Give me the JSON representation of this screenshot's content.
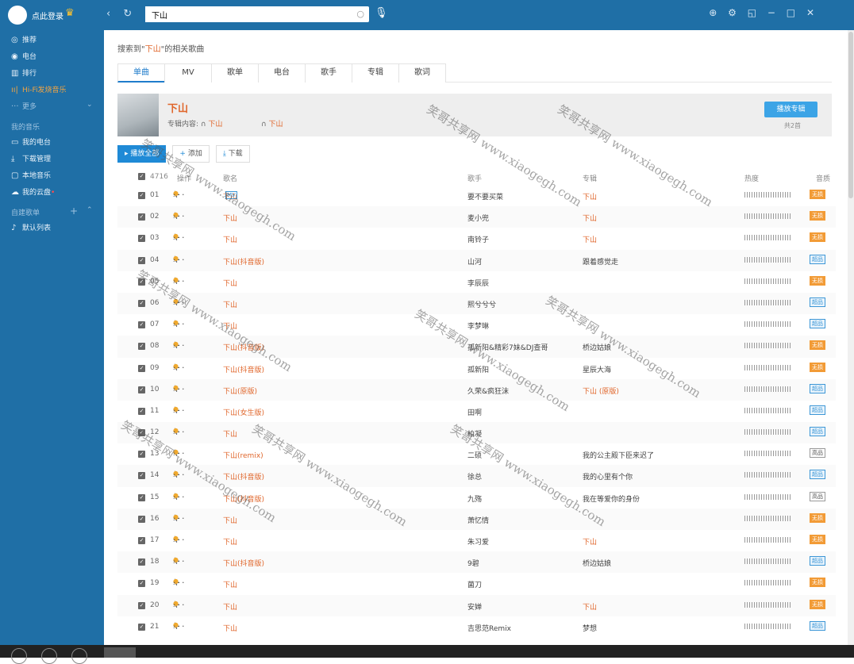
{
  "header": {
    "login_text": "点此登录",
    "search_value": "下山",
    "icons": [
      "back-icon",
      "refresh-icon",
      "search-icon",
      "mic-icon",
      "skin-icon",
      "settings-icon",
      "mini-mode-icon",
      "minimize-icon",
      "maximize-icon",
      "close-icon"
    ]
  },
  "sidebar": {
    "items": [
      {
        "icon": "◎",
        "label": "推荐"
      },
      {
        "icon": "◉",
        "label": "电台"
      },
      {
        "icon": "▥",
        "label": "排行"
      },
      {
        "icon": "ıı|",
        "label": "Hi-Fi发烧音乐"
      },
      {
        "icon": "···",
        "label": "更多"
      }
    ],
    "my_music_title": "我的音乐",
    "my_items": [
      {
        "icon": "▭",
        "label": "我的电台"
      },
      {
        "icon": "⤓",
        "label": "下载管理"
      },
      {
        "icon": "▢",
        "label": "本地音乐"
      },
      {
        "icon": "☁",
        "label": "我的云盘"
      }
    ],
    "playlist_title": "自建歌单",
    "playlist_items": [
      {
        "icon": "♪",
        "label": "默认列表"
      }
    ]
  },
  "search_result": {
    "prefix": "搜索到\"",
    "keyword": "下山",
    "suffix": "\"的相关歌曲"
  },
  "tabs": [
    "单曲",
    "MV",
    "歌单",
    "电台",
    "歌手",
    "专辑",
    "歌词"
  ],
  "album": {
    "title": "下山",
    "sub_label": "专辑内容:",
    "sub_item1": "下山",
    "sub_item2": "下山",
    "play_button": "播放专辑",
    "total": "共2首"
  },
  "buttons": {
    "play_all": "播放全部",
    "add": "添加",
    "download": "下载"
  },
  "table": {
    "headers": {
      "count": "4716",
      "ops": "操作",
      "title": "歌名",
      "singer": "歌手",
      "album": "专辑",
      "heat": "热度",
      "quality": "音质"
    },
    "rows": [
      {
        "num": "01",
        "title": "下山",
        "mv": "MV",
        "singer": "要不要买菜",
        "album": "下山",
        "album_orange": true,
        "quality": "无损",
        "qt": "ls"
      },
      {
        "num": "02",
        "title": "下山",
        "mv": "",
        "singer": "麦小兜",
        "album": "下山",
        "album_orange": true,
        "quality": "无损",
        "qt": "ls"
      },
      {
        "num": "03",
        "title": "下山",
        "mv": "",
        "singer": "南铃子",
        "album": "下山",
        "album_orange": true,
        "quality": "无损",
        "qt": "ls"
      },
      {
        "num": "04",
        "title": "下山(抖音版)",
        "mv": "",
        "singer": "山河",
        "album": "跟着感觉走",
        "album_orange": false,
        "quality": "超品",
        "qt": "sq"
      },
      {
        "num": "05",
        "title": "下山",
        "mv": "",
        "singer": "李辰辰",
        "album": "",
        "album_orange": false,
        "quality": "无损",
        "qt": "ls"
      },
      {
        "num": "06",
        "title": "下山",
        "mv": "",
        "singer": "熙兮兮兮",
        "album": "",
        "album_orange": false,
        "quality": "超品",
        "qt": "sq"
      },
      {
        "num": "07",
        "title": "下山",
        "mv": "",
        "singer": "李梦琳",
        "album": "",
        "album_orange": false,
        "quality": "超品",
        "qt": "sq"
      },
      {
        "num": "08",
        "title": "下山(抖音版)",
        "mv": "",
        "singer": "孤新阳&精彩7妹&DJ查哥",
        "album": "桥边姑娘",
        "album_orange": false,
        "quality": "无损",
        "qt": "ls"
      },
      {
        "num": "09",
        "title": "下山(抖音版)",
        "mv": "",
        "singer": "孤新阳",
        "album": "星辰大海",
        "album_orange": false,
        "quality": "无损",
        "qt": "ls"
      },
      {
        "num": "10",
        "title": "下山(原版)",
        "mv": "",
        "singer": "久荣&疯狂沫",
        "album": "下山 (原版)",
        "album_orange": true,
        "quality": "超品",
        "qt": "sq"
      },
      {
        "num": "11",
        "title": "下山(女生版)",
        "mv": "",
        "singer": "田啊",
        "album": "",
        "album_orange": false,
        "quality": "超品",
        "qt": "sq"
      },
      {
        "num": "12",
        "title": "下山",
        "mv": "",
        "singer": "柏凝",
        "album": "",
        "album_orange": false,
        "quality": "超品",
        "qt": "sq"
      },
      {
        "num": "13",
        "title": "下山(remix)",
        "mv": "",
        "singer": "二硕",
        "album": "我的公主殿下臣来迟了",
        "album_orange": false,
        "quality": "高品",
        "qt": "hq"
      },
      {
        "num": "14",
        "title": "下山(抖音版)",
        "mv": "",
        "singer": "徐总",
        "album": "我的心里有个你",
        "album_orange": false,
        "quality": "超品",
        "qt": "sq"
      },
      {
        "num": "15",
        "title": "下山(抖音版)",
        "mv": "",
        "singer": "九殇",
        "album": "我在等爱你的身份",
        "album_orange": false,
        "quality": "高品",
        "qt": "hq"
      },
      {
        "num": "16",
        "title": "下山",
        "mv": "",
        "singer": "萧忆情",
        "album": "",
        "album_orange": false,
        "quality": "无损",
        "qt": "ls"
      },
      {
        "num": "17",
        "title": "下山",
        "mv": "",
        "singer": "朱习爱",
        "album": "下山",
        "album_orange": true,
        "quality": "无损",
        "qt": "ls"
      },
      {
        "num": "18",
        "title": "下山(抖音版)",
        "mv": "",
        "singer": "9碧",
        "album": "桥边姑娘",
        "album_orange": false,
        "quality": "超品",
        "qt": "sq"
      },
      {
        "num": "19",
        "title": "下山",
        "mv": "",
        "singer": "菌刀",
        "album": "",
        "album_orange": false,
        "quality": "无损",
        "qt": "ls"
      },
      {
        "num": "20",
        "title": "下山",
        "mv": "",
        "singer": "安婵",
        "album": "下山",
        "album_orange": true,
        "quality": "无损",
        "qt": "ls"
      },
      {
        "num": "21",
        "title": "下山",
        "mv": "",
        "singer": "吉思范Remix",
        "album": "梦想",
        "album_orange": false,
        "quality": "超品",
        "qt": "sq"
      }
    ]
  },
  "watermark_text": "笑哥共享网 www.xiaogegh.com"
}
